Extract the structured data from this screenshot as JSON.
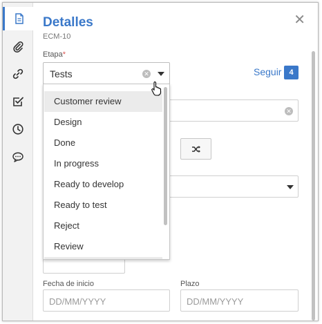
{
  "header": {
    "title": "Detalles",
    "subtitle": "ECM-10"
  },
  "sidebar": {
    "items": [
      {
        "icon": "document-icon"
      },
      {
        "icon": "paperclip-icon"
      },
      {
        "icon": "link-icon"
      },
      {
        "icon": "checkbox-icon"
      },
      {
        "icon": "clock-icon"
      },
      {
        "icon": "comment-icon"
      }
    ]
  },
  "etapa": {
    "label": "Etapa",
    "required_mark": "*",
    "value": "Tests",
    "options": [
      "Customer review",
      "Design",
      "Done",
      "In progress",
      "Ready to develop",
      "Ready to test",
      "Reject",
      "Review"
    ]
  },
  "follow": {
    "label": "Seguir",
    "count": "4"
  },
  "dates": {
    "start_label": "Fecha de inicio",
    "start_placeholder": "DD/MM/YYYY",
    "due_label": "Plazo",
    "due_placeholder": "DD/MM/YYYY"
  },
  "colors": {
    "accent": "#3a78c9",
    "required": "#d9534f"
  }
}
